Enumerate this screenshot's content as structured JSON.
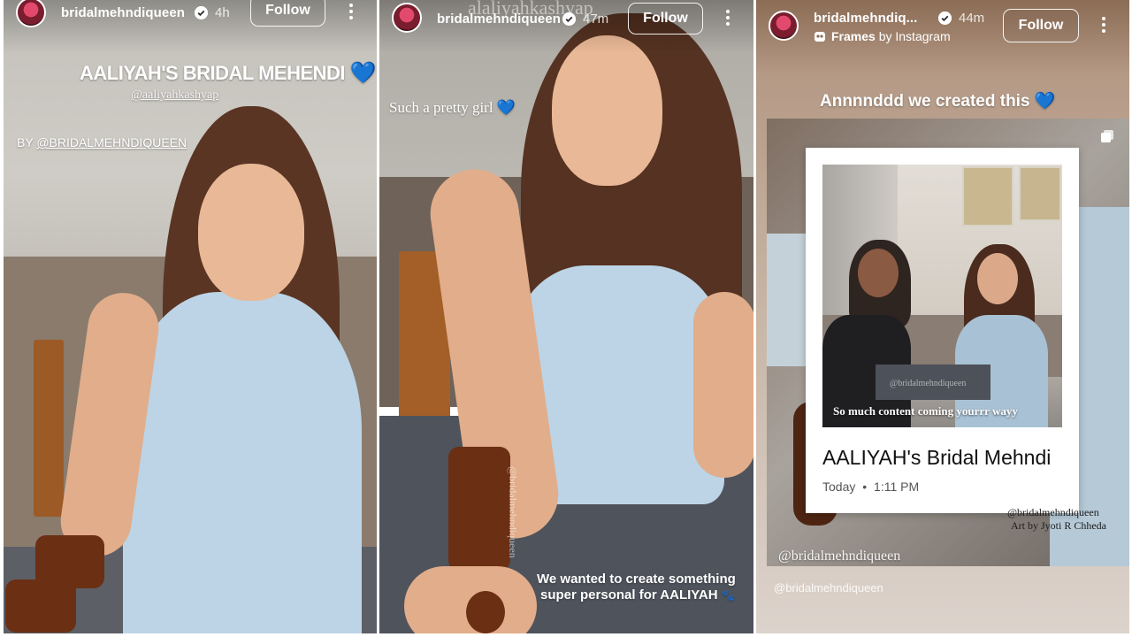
{
  "stories": [
    {
      "username": "bridalmehndiqueen",
      "time": "4h",
      "follow_label": "Follow",
      "title": "AALIYAH'S BRIDAL MEHENDI",
      "title_emoji": "💙",
      "mention": "@aaliyahkashyap",
      "byline_prefix": "BY ",
      "byline_handle": "@BRIDALMEHNDIQUEEN"
    },
    {
      "username": "bridalmehndiqueen",
      "time": "47m",
      "follow_label": "Follow",
      "caption": "Such a pretty girl",
      "caption_emoji": "💙",
      "watermark_top": "alaliyahkashyap",
      "watermark_vertical": "@bridalmehndiqueen",
      "bottom_line_1": "We wanted to create something",
      "bottom_line_2": "super personal for AALIYAH",
      "bottom_emoji": "🐾"
    },
    {
      "username": "bridalmehndiq...",
      "time": "44m",
      "follow_label": "Follow",
      "frames_label": "Frames",
      "frames_suffix": "by Instagram",
      "headline": "Annnnddd we created this",
      "headline_emoji": "💙",
      "card_photo_caption": "So much content coming yourrr wayy",
      "card_watermark": "@bridalmehndiqueen",
      "card_title": "AALIYAH's Bridal Mehndi",
      "card_date_day": "Today",
      "card_date_time": "1:11 PM",
      "credit_handle": "@bridalmehndiqueen",
      "credit_art": "Art by Jyoti R Chheda",
      "bottom_handle": "@bridalmehndiqueen",
      "footer_handle": "@bridalmehndiqueen"
    }
  ],
  "colors": {
    "heart_blue": "#7ec6ef",
    "dress_blue": "#bcd4e6",
    "henna_brown": "#6b2f14",
    "wall_gray": "#c9c6c0"
  },
  "icons": [
    "verified-badge-icon",
    "more-options-icon",
    "frames-icon",
    "layers-icon"
  ]
}
